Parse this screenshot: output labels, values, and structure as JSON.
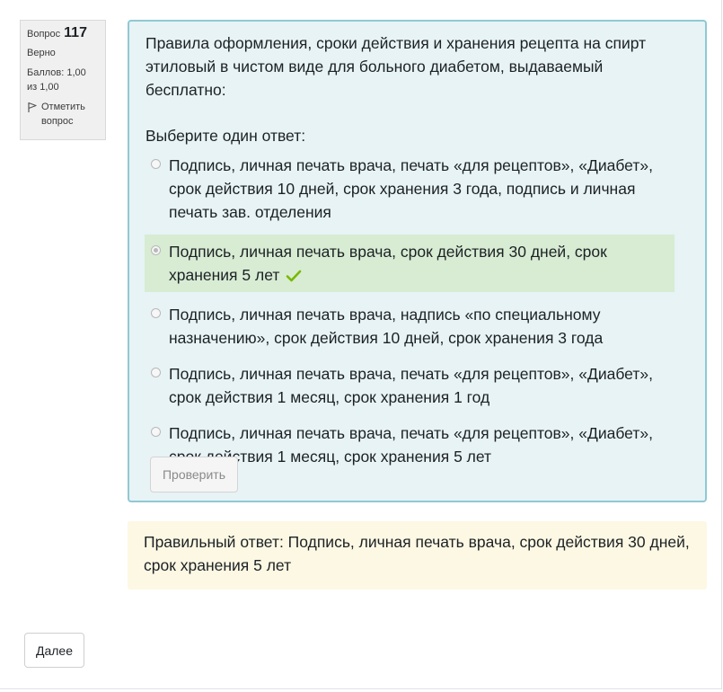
{
  "question_info": {
    "label": "Вопрос",
    "number": "117",
    "state": "Верно",
    "grade": "Баллов: 1,00 из 1,00",
    "flag_label": "Отметить вопрос"
  },
  "question": {
    "text": "Правила оформления, сроки действия и хранения рецепта на спирт этиловый в чистом виде для больного диабетом, выдаваемый бесплатно:",
    "prompt": "Выберите один ответ:",
    "answers": [
      {
        "label": "Подпись, личная печать врача, печать «для рецептов», «Диабет», срок действия 10 дней, срок хранения 3 года, подпись и личная печать зав. отделения",
        "selected": false,
        "correct": false
      },
      {
        "label": "Подпись, личная печать врача, срок действия 30 дней, срок хранения 5 лет",
        "selected": true,
        "correct": true
      },
      {
        "label": "Подпись, личная печать врача, надпись «по специальному назначению», срок действия 10 дней, срок хранения 3 года",
        "selected": false,
        "correct": false
      },
      {
        "label": "Подпись, личная печать врача, печать «для рецептов», «Диабет», срок действия 1 месяц, срок хранения 1 год",
        "selected": false,
        "correct": false
      },
      {
        "label": "Подпись, личная печать врача, печать «для рецептов», «Диабет», срок действия 1 месяц, срок хранения 5 лет",
        "selected": false,
        "correct": false
      }
    ],
    "check_button": "Проверить"
  },
  "feedback": {
    "right_answer": "Правильный ответ: Подпись, личная печать врача, срок действия 30 дней, срок хранения 5 лет"
  },
  "navigation": {
    "next_button": "Далее"
  },
  "colors": {
    "content_bg": "#e7f3f5",
    "content_border": "#8fc9d3",
    "correct_bg": "#d7ecd3",
    "checkmark": "#7ab800",
    "feedback_bg": "#fcf8e3"
  },
  "icons": {
    "flag": "flag-icon",
    "correct": "checkmark-icon"
  }
}
